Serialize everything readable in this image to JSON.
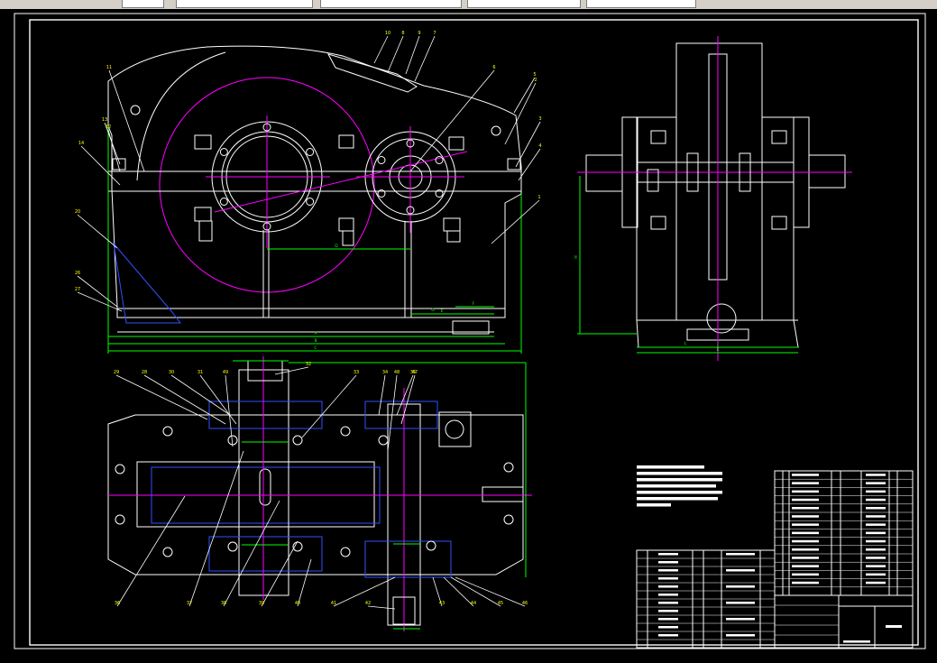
{
  "app": {
    "title": ""
  },
  "toolbar": {
    "segments": [
      "",
      "",
      "",
      "",
      "",
      ""
    ]
  },
  "colors": {
    "background": "#000000",
    "outline": "#ffffff",
    "centerline": "#ff00ff",
    "dimension": "#00ff00",
    "section_hatch": "#3050ff",
    "fastener": "#ffff00",
    "label": "#ffff00",
    "leader": "#ffffff"
  },
  "front_view_labels": [
    "11",
    "13",
    "12",
    "14",
    "20",
    "26",
    "27",
    "10",
    "8",
    "9",
    "7",
    "6",
    "5",
    "3",
    "4",
    "1",
    "2"
  ],
  "front_view_dims": [
    "A",
    "B",
    "C",
    "D",
    "E",
    "F",
    "G"
  ],
  "top_view_labels": [
    "29",
    "28",
    "30",
    "31",
    "32",
    "33",
    "34",
    "35",
    "36",
    "37",
    "38",
    "39",
    "40",
    "41",
    "42",
    "43",
    "44",
    "45",
    "46",
    "47",
    "48",
    "49"
  ],
  "side_view_dims": [
    "H",
    "J",
    "K",
    "L"
  ],
  "notes": {
    "lines": 7
  },
  "parts_list": {
    "rows": 15
  },
  "title_block": {
    "rows": 4
  }
}
